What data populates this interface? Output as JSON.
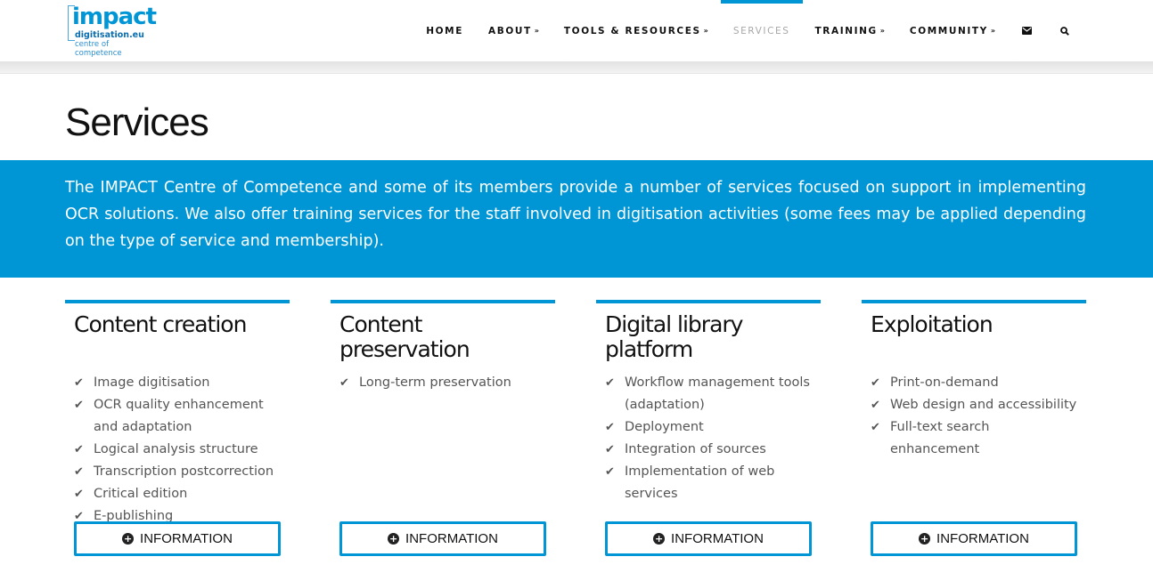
{
  "logo": {
    "word": "impact",
    "domain": "digitisation.eu",
    "tagline": "centre of competence"
  },
  "nav": {
    "items": [
      {
        "label": "HOME",
        "chevron": ""
      },
      {
        "label": "ABOUT",
        "chevron": "»"
      },
      {
        "label": "TOOLS & RESOURCES",
        "chevron": "»"
      },
      {
        "label": "SERVICES",
        "chevron": ""
      },
      {
        "label": "TRAINING",
        "chevron": "»"
      },
      {
        "label": "COMMUNITY",
        "chevron": "»"
      }
    ],
    "active": "SERVICES",
    "icons": [
      "envelope-icon",
      "search-icon"
    ]
  },
  "page": {
    "title": "Services",
    "intro": "The IMPACT Centre of Competence and some of its members provide a number of services focused on support in implementing OCR solutions. We also offer training services for the staff involved in digitisation activities (some fees may be applied depending on the type of service and membership)."
  },
  "columns": [
    {
      "title": "Content creation",
      "items": [
        "Image digitisation",
        "OCR quality enhancement and adaptation",
        "Logical analysis structure",
        "Transcription postcorrection",
        "Critical edition",
        "E-publishing"
      ],
      "button": "INFORMATION"
    },
    {
      "title": "Content preservation",
      "items": [
        "Long-term preservation"
      ],
      "button": "INFORMATION"
    },
    {
      "title": "Digital library platform",
      "items": [
        "Workflow management tools (adaptation)",
        "Deployment",
        "Integration of sources",
        "Implementation of web services"
      ],
      "button": "INFORMATION"
    },
    {
      "title": "Exploitation",
      "items": [
        "Print-on-demand",
        "Web design and accessibility",
        "Full-text search enhancement"
      ],
      "button": "INFORMATION"
    }
  ],
  "colors": {
    "accent": "#0096d6",
    "text": "#111111",
    "muted": "#555555"
  }
}
